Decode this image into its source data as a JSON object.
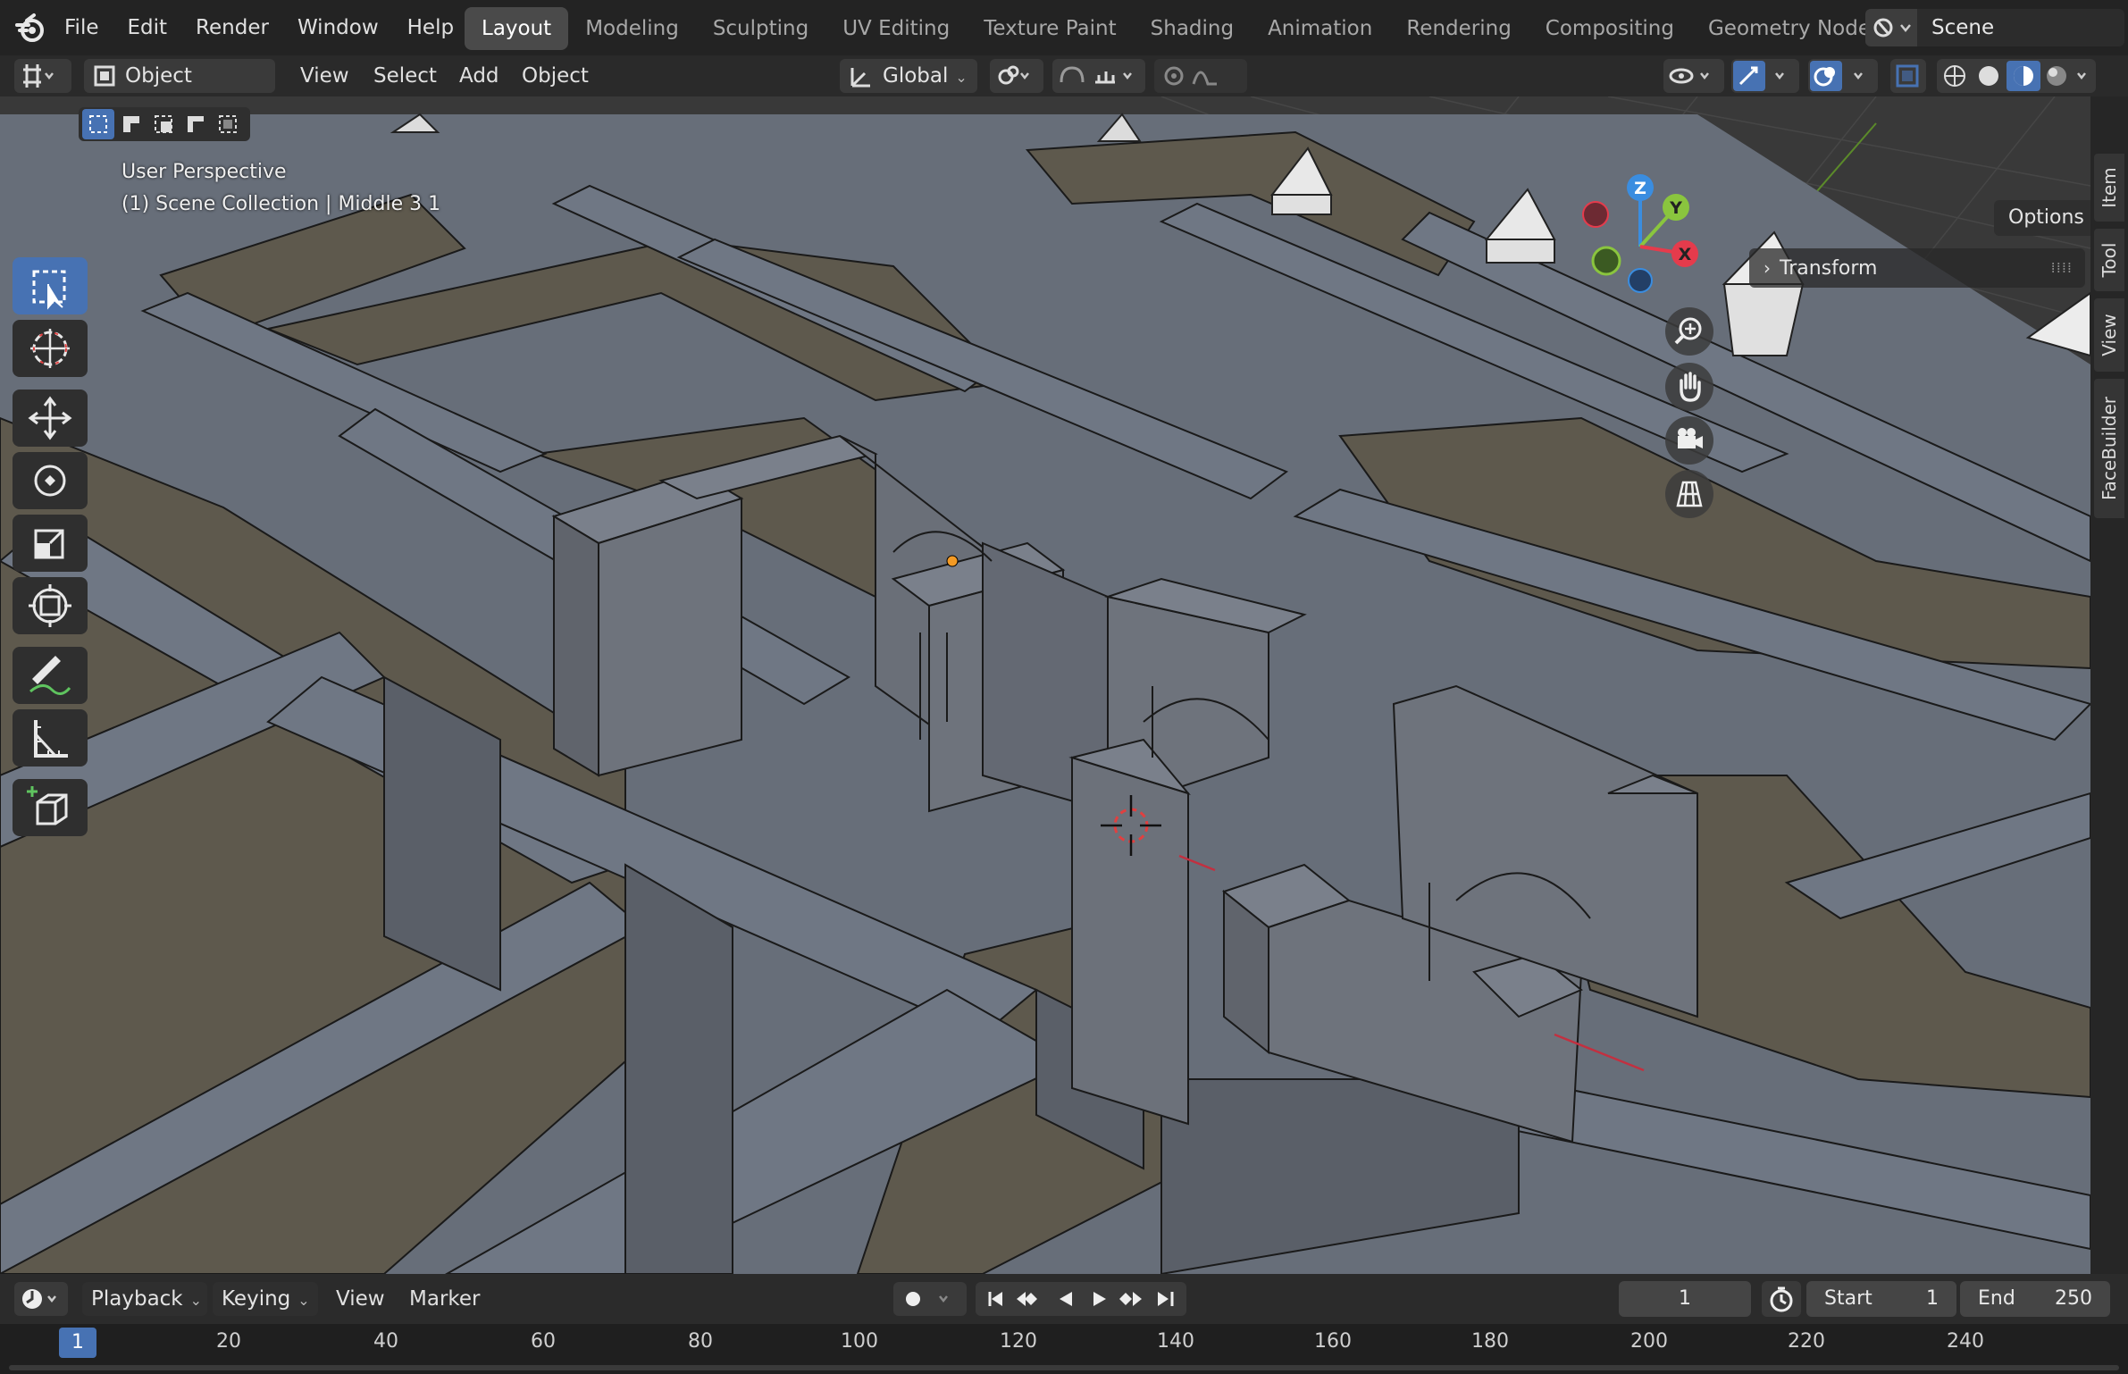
{
  "app": {
    "logo": "blender-logo-icon"
  },
  "menu": [
    "File",
    "Edit",
    "Render",
    "Window",
    "Help"
  ],
  "workspaces": [
    "Layout",
    "Modeling",
    "Sculpting",
    "UV Editing",
    "Texture Paint",
    "Shading",
    "Animation",
    "Rendering",
    "Compositing",
    "Geometry Nodes"
  ],
  "active_workspace": "Layout",
  "scene": {
    "label": "Scene"
  },
  "header": {
    "mode": "Object Mode",
    "menus": [
      "View",
      "Select",
      "Add",
      "Object"
    ],
    "orientation": "Global"
  },
  "viewport": {
    "perspective": "User Perspective",
    "collection": "(1) Scene Collection | Middle 3 1",
    "options_label": "Options",
    "transform_label": "Transform",
    "gizmo": {
      "x": "X",
      "y": "Y",
      "z": "Z"
    }
  },
  "sidebar_tabs": [
    "Item",
    "Tool",
    "View",
    "FaceBuilder"
  ],
  "tools": [
    "select-box-icon",
    "cursor-icon",
    "move-icon",
    "rotate-icon",
    "scale-icon",
    "transform-icon",
    "annotate-icon",
    "measure-icon",
    "add-cube-icon"
  ],
  "timeline": {
    "menus": [
      "Playback",
      "Keying",
      "View",
      "Marker"
    ],
    "current_frame": "1",
    "start_label": "Start",
    "start": "1",
    "end_label": "End",
    "end": "250",
    "ruler": [
      "1",
      "20",
      "40",
      "60",
      "80",
      "100",
      "120",
      "140",
      "160",
      "180",
      "200",
      "220",
      "240"
    ]
  },
  "colors": {
    "accent": "#4772b3",
    "x_axis": "#e53b4c",
    "y_axis": "#8ac53e",
    "z_axis": "#3a8de0"
  }
}
